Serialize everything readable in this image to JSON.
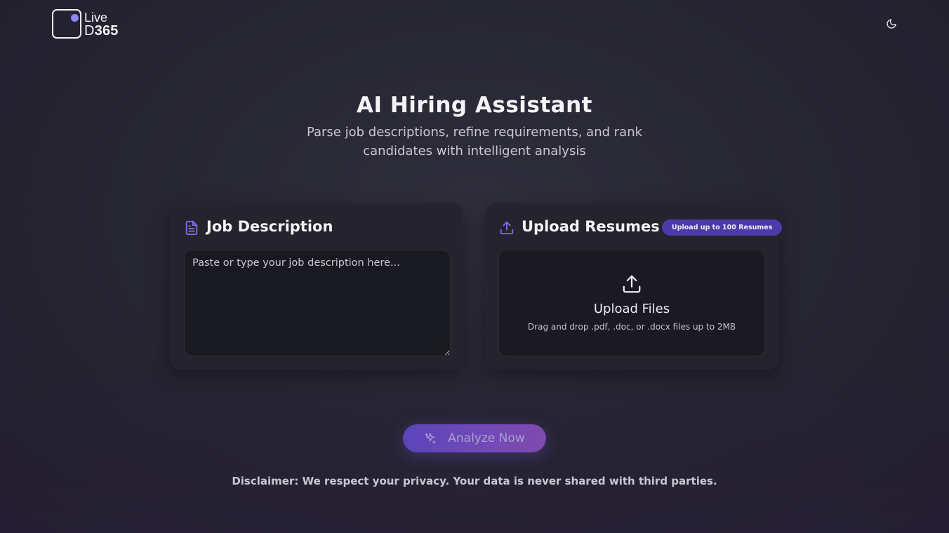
{
  "brand": {
    "line1": "Live",
    "line2_prefix": "D",
    "line2_bold": "365",
    "dot_color": "#8f86f4"
  },
  "header": {
    "theme_toggle_icon": "moon-icon"
  },
  "hero": {
    "title": "AI Hiring Assistant",
    "subtitle": "Parse job descriptions, refine requirements, and rank candidates with intelligent analysis"
  },
  "job_description": {
    "icon": "document-icon",
    "title": "Job Description",
    "placeholder": "Paste or type your job description here...",
    "value": ""
  },
  "upload": {
    "icon": "upload-icon",
    "title": "Upload Resumes",
    "badge": "Upload up to 100 Resumes",
    "dropzone_title": "Upload Files",
    "dropzone_hint": "Drag and drop .pdf, .doc, or .docx files up to 2MB"
  },
  "actions": {
    "analyze_label": "Analyze Now",
    "analyze_icon": "sparkles-icon"
  },
  "footer": {
    "disclaimer": "Disclaimer: We respect your privacy. Your data is never shared with third parties."
  },
  "colors": {
    "accent": "#6d54e0",
    "badge_bg": "#4b3aa8",
    "background": "#272633",
    "card_bg": "#25242e"
  }
}
